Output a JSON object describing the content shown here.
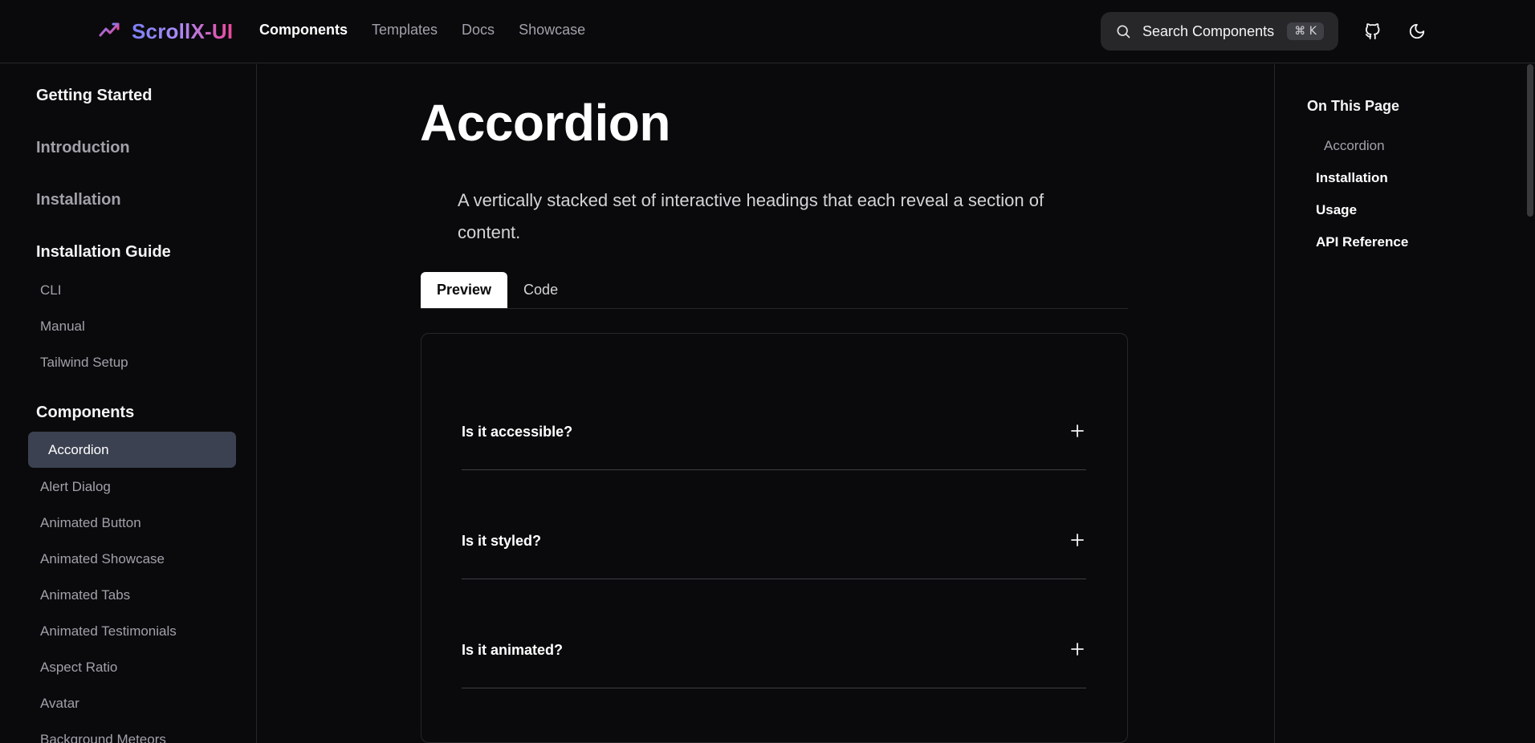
{
  "header": {
    "brand": "ScrollX-UI",
    "nav": [
      "Components",
      "Templates",
      "Docs",
      "Showcase"
    ],
    "active_nav": "Components",
    "search": {
      "label": "Search Components",
      "shortcut": "⌘ K"
    }
  },
  "sidebar": {
    "getting_started": "Getting Started",
    "links": [
      "Introduction",
      "Installation"
    ],
    "installation_guide": {
      "title": "Installation Guide",
      "items": [
        "CLI",
        "Manual",
        "Tailwind Setup"
      ]
    },
    "components": {
      "title": "Components",
      "active": "Accordion",
      "items": [
        "Alert Dialog",
        "Animated Button",
        "Animated Showcase",
        "Animated Tabs",
        "Animated Testimonials",
        "Aspect Ratio",
        "Avatar",
        "Background Meteors"
      ]
    }
  },
  "main": {
    "title": "Accordion",
    "description": "A vertically stacked set of interactive headings that each reveal a section of content.",
    "tabs": [
      "Preview",
      "Code"
    ],
    "active_tab": "Preview",
    "accordion": [
      {
        "question": "Is it accessible?"
      },
      {
        "question": "Is it styled?"
      },
      {
        "question": "Is it animated?"
      }
    ]
  },
  "toc": {
    "title": "On This Page",
    "items": [
      "Accordion",
      "Installation",
      "Usage",
      "API Reference"
    ]
  },
  "colors": {
    "background": "#0a0a0c",
    "border": "#27272a",
    "brand_gradient_start": "#7c7ff5",
    "brand_gradient_end": "#ec4899",
    "active_sidebar": "#3b4150"
  },
  "icons": {
    "brand": "trending-chart-icon",
    "search": "search-icon",
    "github": "github-icon",
    "theme": "moon-icon",
    "accordion_toggle": "plus-icon"
  }
}
